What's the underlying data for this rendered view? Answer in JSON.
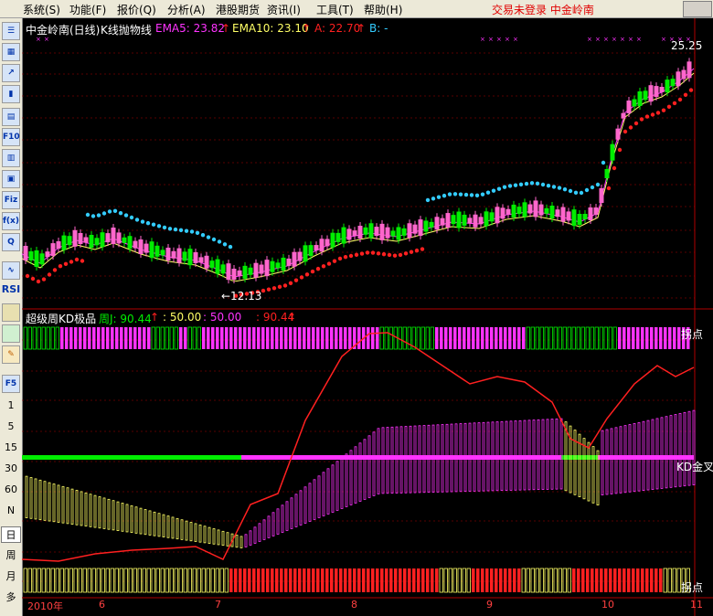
{
  "menu": [
    "系统(S)",
    "功能(F)",
    "报价(Q)",
    "分析(A)",
    "港股期货",
    "资讯(I)",
    "工具(T)",
    "帮助(H)"
  ],
  "status": "交易未登录  中金岭南",
  "toolbar": {
    "icons": [
      {
        "name": "list-icon",
        "glyph": "☰"
      },
      {
        "name": "grid-icon",
        "glyph": "▦"
      },
      {
        "name": "line-chart-icon",
        "glyph": "↗"
      },
      {
        "name": "candle-icon",
        "glyph": "▮"
      },
      {
        "name": "doc-icon",
        "glyph": "▤"
      },
      {
        "name": "f10-icon",
        "glyph": "F10"
      },
      {
        "name": "calc-icon",
        "glyph": "▥"
      },
      {
        "name": "bookmark-icon",
        "glyph": "▣"
      },
      {
        "name": "fiz-icon",
        "glyph": "Fiz"
      },
      {
        "name": "fx-icon",
        "glyph": "f(x)"
      },
      {
        "name": "search-icon",
        "glyph": "Q"
      },
      {
        "name": "wave-icon",
        "glyph": "∿"
      }
    ],
    "rsi": "RSI",
    "f5": "F5",
    "periods": [
      "1",
      "5",
      "15",
      "30",
      "60",
      "N",
      "日",
      "周",
      "月",
      "多"
    ]
  },
  "upper": {
    "title": "中金岭南(日线)",
    "indicator": "K线抛物线",
    "ema5": "EMA5: 23.82",
    "ema10": "EMA10: 23.10",
    "a": "A: 22.70",
    "b": "B: -",
    "high_label": "25.25",
    "low_label": "←12.13"
  },
  "lower": {
    "title": "超级周KD极品",
    "j": "周J: 90.44",
    "v1": ": 50.00",
    "v2": ": 50.00",
    "v3": ": 90.44",
    "label_top": "拐点",
    "label_mid": "KD金叉",
    "label_bot": "拐点"
  },
  "xaxis": [
    {
      "label": "2010年"
    },
    {
      "label": "6"
    },
    {
      "label": "7"
    },
    {
      "label": "8"
    },
    {
      "label": "9"
    },
    {
      "label": "10"
    },
    {
      "label": "11"
    }
  ],
  "colors": {
    "up": "#ff66cc",
    "down": "#00ee00",
    "red": "#ff2020",
    "cyan": "#33ccff",
    "axis": "#b00000",
    "yellow": "#ffff66",
    "magenta": "#ff33ff"
  }
}
